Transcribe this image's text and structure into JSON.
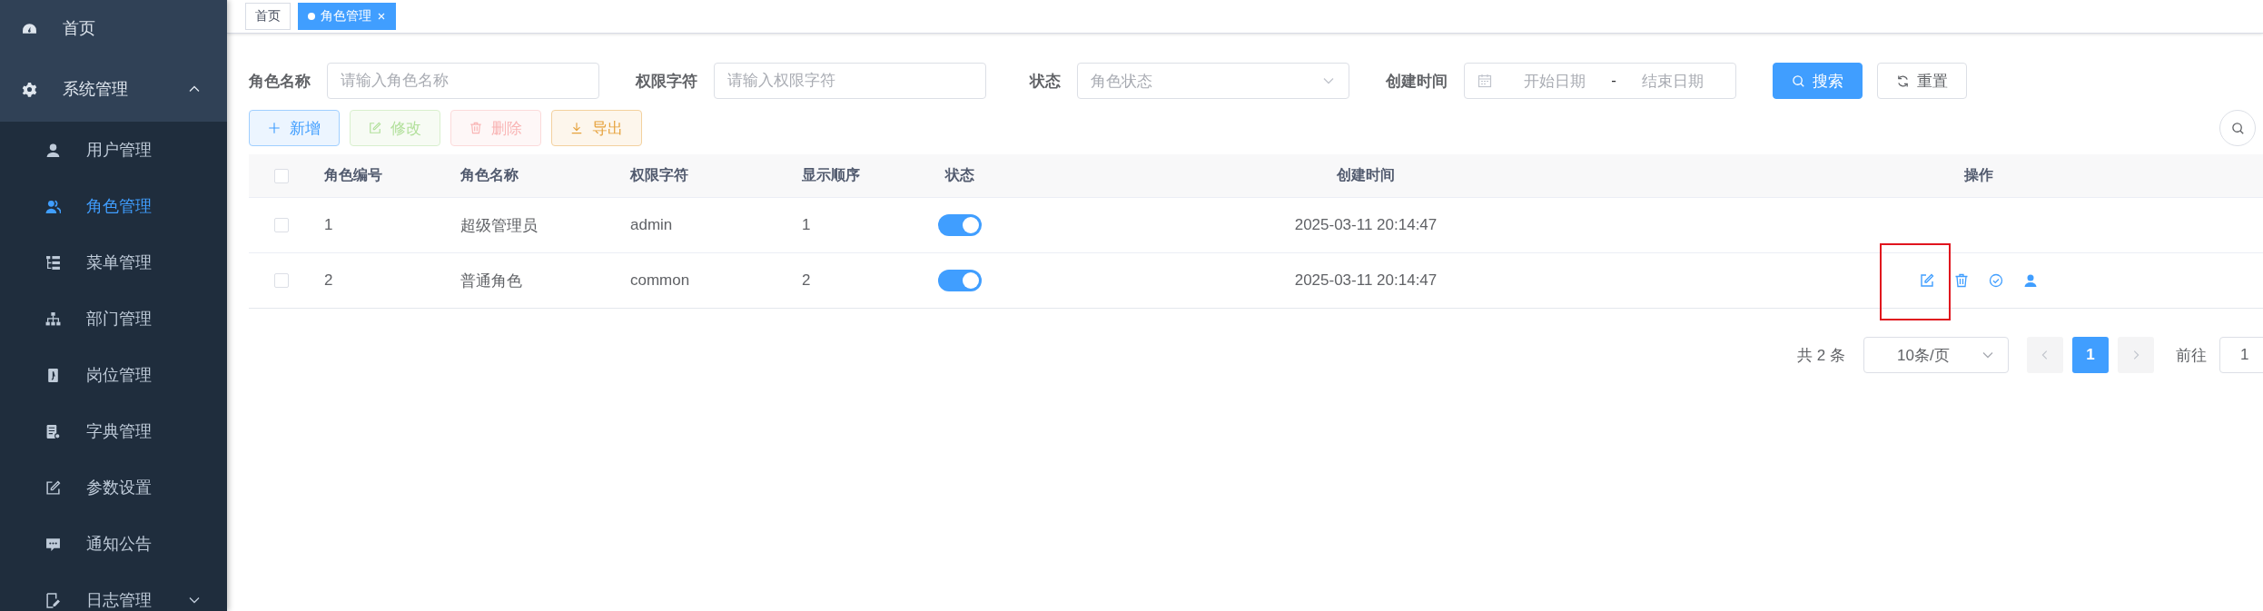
{
  "sidebar": {
    "items": [
      {
        "label": "首页",
        "kind": "dashboard",
        "selected": false
      },
      {
        "label": "系统管理",
        "kind": "gear",
        "selected": false,
        "expanded": true,
        "children": [
          {
            "label": "用户管理",
            "kind": "user",
            "selected": false
          },
          {
            "label": "角色管理",
            "kind": "users",
            "selected": true
          },
          {
            "label": "菜单管理",
            "kind": "tree",
            "selected": false
          },
          {
            "label": "部门管理",
            "kind": "sitemap",
            "selected": false
          },
          {
            "label": "岗位管理",
            "kind": "badge",
            "selected": false
          },
          {
            "label": "字典管理",
            "kind": "book",
            "selected": false
          },
          {
            "label": "参数设置",
            "kind": "edit",
            "selected": false
          },
          {
            "label": "通知公告",
            "kind": "chat",
            "selected": false
          },
          {
            "label": "日志管理",
            "kind": "log",
            "selected": false,
            "expanded": false
          }
        ]
      }
    ]
  },
  "tags": [
    {
      "label": "首页",
      "selected": false,
      "closable": false
    },
    {
      "label": "角色管理",
      "selected": true,
      "closable": true
    }
  ],
  "filters": [
    {
      "kind": "input",
      "label": "角色名称",
      "placeholder": "请输入角色名称"
    },
    {
      "kind": "input",
      "label": "权限字符",
      "placeholder": "请输入权限字符"
    },
    {
      "kind": "select",
      "label": "状态",
      "placeholder": "角色状态"
    },
    {
      "kind": "daterange",
      "label": "创建时间",
      "start_placeholder": "开始日期",
      "separator": "-",
      "end_placeholder": "结束日期"
    }
  ],
  "filter_buttons": [
    {
      "label": "搜索",
      "kind": "search"
    },
    {
      "label": "重置",
      "kind": "reset"
    }
  ],
  "toolbar": [
    {
      "label": "新增",
      "kind": "add",
      "disabled": false
    },
    {
      "label": "修改",
      "kind": "edit",
      "disabled": true
    },
    {
      "label": "删除",
      "kind": "delete",
      "disabled": true
    },
    {
      "label": "导出",
      "kind": "export",
      "disabled": false
    }
  ],
  "table": {
    "columns": [
      "角色编号",
      "角色名称",
      "权限字符",
      "显示顺序",
      "状态",
      "创建时间",
      "操作"
    ],
    "header_checked": false,
    "rows": [
      {
        "checked": false,
        "id": "1",
        "name": "超级管理员",
        "key": "admin",
        "sort": "1",
        "status_on": true,
        "created": "2025-03-11 20:14:47",
        "actions": []
      },
      {
        "checked": false,
        "id": "2",
        "name": "普通角色",
        "key": "common",
        "sort": "2",
        "status_on": true,
        "created": "2025-03-11 20:14:47",
        "actions": [
          {
            "kind": "edit",
            "highlighted": true
          },
          {
            "kind": "delete",
            "highlighted": false
          },
          {
            "kind": "check",
            "highlighted": false
          },
          {
            "kind": "user",
            "highlighted": false
          }
        ]
      }
    ]
  },
  "pagination": {
    "total": "共 2 条",
    "page_size": "10条/页",
    "prev_disabled": true,
    "next_disabled": true,
    "pages": [
      {
        "label": "1",
        "selected": true
      }
    ],
    "goto_label": "前往",
    "goto_value": "1"
  }
}
